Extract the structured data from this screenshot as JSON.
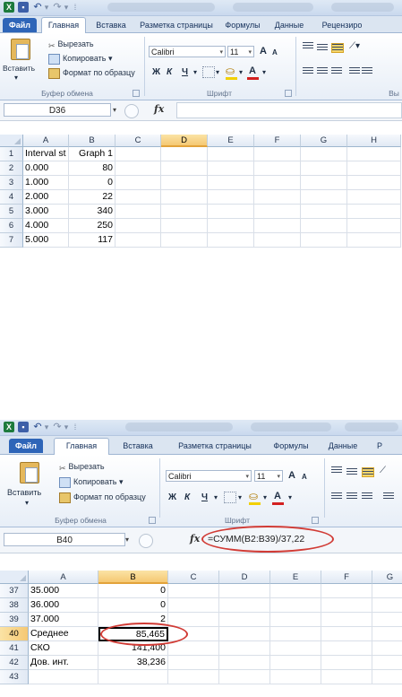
{
  "colors": {
    "accent": "#2e65b8",
    "highlight_ellipse": "#d13b35",
    "selected_header": "#f5c873"
  },
  "ribbon": {
    "tabs": [
      "Файл",
      "Главная",
      "Вставка",
      "Разметка страницы",
      "Формулы",
      "Данные",
      "Рецензиро"
    ],
    "tabs2": [
      "Файл",
      "Главная",
      "Вставка",
      "Разметка страницы",
      "Формулы",
      "Данные",
      "Р"
    ],
    "clipboard": {
      "paste": "Вставить",
      "cut": "Вырезать",
      "copy": "Копировать",
      "format_painter": "Формат по образцу",
      "group_label": "Буфер обмена"
    },
    "font": {
      "name": "Calibri",
      "size": "11",
      "bold": "Ж",
      "italic": "К",
      "underline": "Ч",
      "group_label": "Шрифт",
      "grow": "A",
      "shrink": "A",
      "fontcolor": "A"
    },
    "alignment_group_partial": "Вы",
    "icons": [
      "excel-app-icon",
      "save-icon",
      "undo-icon",
      "redo-icon",
      "cut-scissors-icon",
      "copy-icon",
      "format-painter-icon",
      "paste-clipboard-icon",
      "borders-icon",
      "fill-color-icon",
      "font-color-icon",
      "align-top-icon",
      "align-middle-icon",
      "align-bottom-icon",
      "orientation-icon",
      "align-left-icon",
      "align-center-icon",
      "align-right-icon",
      "decrease-indent-icon",
      "increase-indent-icon"
    ]
  },
  "screen1": {
    "name_box": "D36",
    "formula": "",
    "fx": "fx",
    "columns": [
      "A",
      "B",
      "C",
      "D",
      "E",
      "F",
      "G",
      "H"
    ],
    "selected_column": "D",
    "rows": [
      {
        "n": "1",
        "a": "Interval st",
        "b": "Graph 1"
      },
      {
        "n": "2",
        "a": "0.000",
        "b": "80"
      },
      {
        "n": "3",
        "a": "1.000",
        "b": "0"
      },
      {
        "n": "4",
        "a": "2.000",
        "b": "22"
      },
      {
        "n": "5",
        "a": "3.000",
        "b": "340"
      },
      {
        "n": "6",
        "a": "4.000",
        "b": "250"
      },
      {
        "n": "7",
        "a": "5.000",
        "b": "117"
      }
    ]
  },
  "screen2": {
    "name_box": "B40",
    "formula": "=СУММ(B2:B39)/37,22",
    "fx": "fx",
    "columns": [
      "A",
      "B",
      "C",
      "D",
      "E",
      "F",
      "G"
    ],
    "selected_column": "B",
    "selected_row": "40",
    "rows": [
      {
        "n": "37",
        "a": "35.000",
        "b": "0"
      },
      {
        "n": "38",
        "a": "36.000",
        "b": "0"
      },
      {
        "n": "39",
        "a": "37.000",
        "b": "2"
      },
      {
        "n": "40",
        "a": "Среднее",
        "b": "85,465"
      },
      {
        "n": "41",
        "a": "СКО",
        "b": "141,400"
      },
      {
        "n": "42",
        "a": "Дов. инт.",
        "b": "38,236"
      },
      {
        "n": "43",
        "a": "",
        "b": ""
      }
    ]
  }
}
